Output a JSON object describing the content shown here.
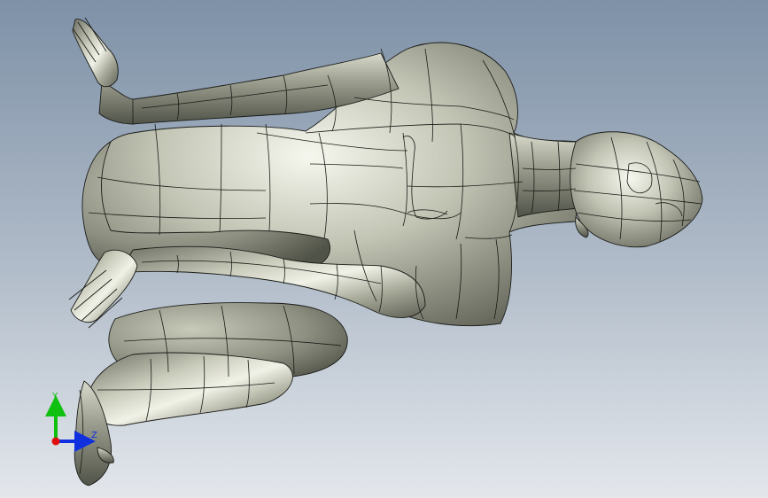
{
  "viewport": {
    "background_top": "#7d90a6",
    "background_bottom": "#dfe4ea",
    "model_fill": "#b9bbab",
    "model_highlight": "#f3f4ea",
    "model_shadow": "#5b5e52",
    "edge_color": "#1b1c18"
  },
  "triad": {
    "x_color": "#e01010",
    "y_color": "#10c010",
    "z_color": "#1030e0",
    "y_label": "Y",
    "z_label": "Z"
  }
}
